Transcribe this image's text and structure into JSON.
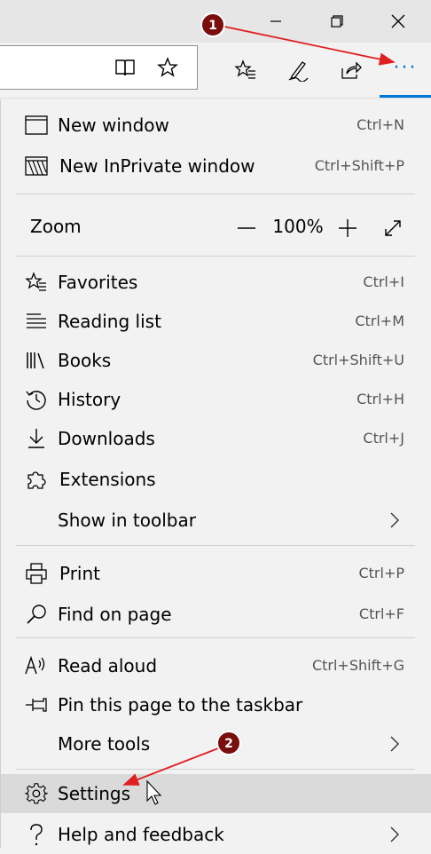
{
  "colors": {
    "accent": "#0078d7",
    "annotation_red": "#e02020",
    "badge_dark_red": "#7a0d0d"
  },
  "window_controls": {
    "minimize_icon": "minimize-icon",
    "restore_icon": "restore-icon",
    "close_icon": "close-icon"
  },
  "toolbar": {
    "icons": [
      "reading-view-icon",
      "favorite-star-icon",
      "favorites-hub-icon",
      "web-note-icon",
      "share-icon"
    ],
    "more_label": "···"
  },
  "menu": {
    "window_items": [
      {
        "label": "New window",
        "shortcut": "Ctrl+N",
        "icon": "new-window-icon"
      },
      {
        "label": "New InPrivate window",
        "shortcut": "Ctrl+Shift+P",
        "icon": "inprivate-icon"
      }
    ],
    "zoom": {
      "label": "Zoom",
      "value": "100%",
      "decrease": "—",
      "increase": "+",
      "fullscreen_icon": "fullscreen-icon"
    },
    "hub_items": [
      {
        "label": "Favorites",
        "shortcut": "Ctrl+I",
        "icon": "favorites-icon"
      },
      {
        "label": "Reading list",
        "shortcut": "Ctrl+M",
        "icon": "reading-list-icon"
      },
      {
        "label": "Books",
        "shortcut": "Ctrl+Shift+U",
        "icon": "books-icon"
      },
      {
        "label": "History",
        "shortcut": "Ctrl+H",
        "icon": "history-icon"
      },
      {
        "label": "Downloads",
        "shortcut": "Ctrl+J",
        "icon": "downloads-icon"
      },
      {
        "label": "Extensions",
        "icon": "extensions-icon"
      },
      {
        "label": "Show in toolbar",
        "has_submenu": true
      }
    ],
    "page_items": [
      {
        "label": "Print",
        "shortcut": "Ctrl+P",
        "icon": "print-icon"
      },
      {
        "label": "Find on page",
        "shortcut": "Ctrl+F",
        "icon": "search-icon"
      }
    ],
    "tool_items": [
      {
        "label": "Read aloud",
        "shortcut": "Ctrl+Shift+G",
        "icon": "read-aloud-icon"
      },
      {
        "label": "Pin this page to the taskbar",
        "icon": "pin-icon"
      },
      {
        "label": "More tools",
        "has_submenu": true
      }
    ],
    "bottom_items": [
      {
        "label": "Settings",
        "icon": "gear-icon",
        "hovered": true
      },
      {
        "label": "Help and feedback",
        "icon": "help-icon",
        "has_submenu": true
      }
    ]
  },
  "annotations": [
    {
      "number": "1"
    },
    {
      "number": "2"
    }
  ]
}
